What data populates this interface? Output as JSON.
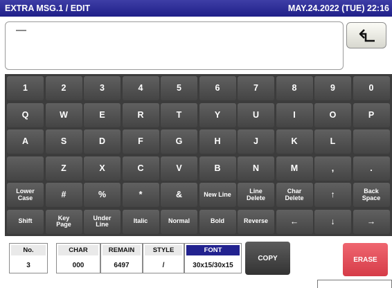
{
  "header": {
    "title": "EXTRA MSG.1 / EDIT",
    "datetime": "MAY.24.2022 (TUE) 22:16"
  },
  "editor": {
    "text": ""
  },
  "enter_button": {
    "icon": "return-arrow-icon"
  },
  "keyboard": {
    "rows": [
      [
        "1",
        "2",
        "3",
        "4",
        "5",
        "6",
        "7",
        "8",
        "9",
        "0"
      ],
      [
        "Q",
        "W",
        "E",
        "R",
        "T",
        "Y",
        "U",
        "I",
        "O",
        "P"
      ],
      [
        "A",
        "S",
        "D",
        "F",
        "G",
        "H",
        "J",
        "K",
        "L",
        ""
      ],
      [
        "",
        "Z",
        "X",
        "C",
        "V",
        "B",
        "N",
        "M",
        ",",
        "."
      ],
      [
        "Lower\nCase",
        "#",
        "%",
        "*",
        "&",
        "New Line",
        "Line\nDelete",
        "Char\nDelete",
        "↑",
        "Back\nSpace"
      ],
      [
        "Shift",
        "Key\nPage",
        "Under\nLine",
        "Italic",
        "Normal",
        "Bold",
        "Reverse",
        "←",
        "↓",
        "→"
      ]
    ]
  },
  "status": {
    "no_label": "No.",
    "no_value": "3",
    "char_label": "CHAR",
    "char_value": "000",
    "remain_label": "REMAIN",
    "remain_value": "6497",
    "style_label": "STYLE",
    "style_value": "/",
    "font_label": "FONT",
    "font_value": "30x15/30x15"
  },
  "buttons": {
    "copy": "COPY",
    "erase": "ERASE"
  },
  "colors": {
    "title_bar": "#23238f",
    "key": "#4f4f4f",
    "erase": "#e04f5a"
  }
}
